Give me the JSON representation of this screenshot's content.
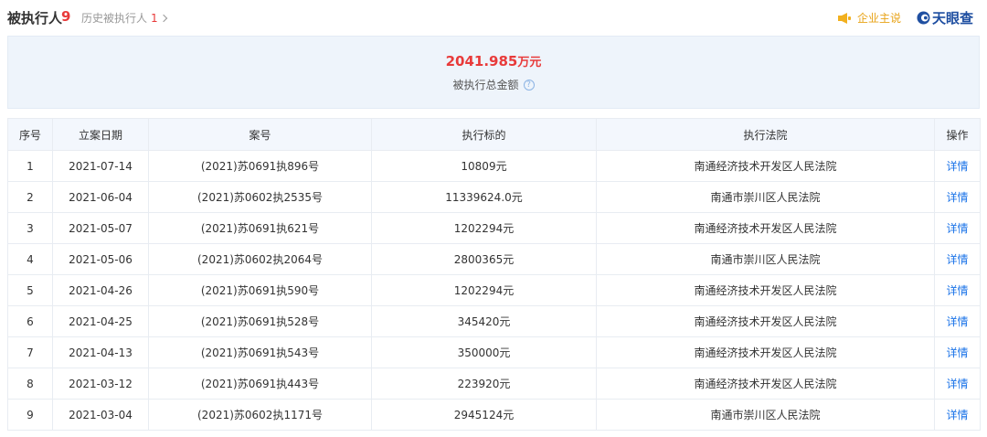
{
  "header": {
    "title": "被执行人",
    "title_count": "9",
    "history_label": "历史被执行人",
    "history_count": "1",
    "enterprise_say_label": "企业主说",
    "logo_text": "天眼查"
  },
  "summary": {
    "amount": "2041.985",
    "amount_unit": "万元",
    "label": "被执行总金额"
  },
  "table": {
    "columns": [
      "序号",
      "立案日期",
      "案号",
      "执行标的",
      "执行法院",
      "操作"
    ],
    "rows": [
      {
        "no": "1",
        "date": "2021-07-14",
        "case_no": "(2021)苏0691执896号",
        "amount": "10809元",
        "court": "南通经济技术开发区人民法院",
        "action": "详情"
      },
      {
        "no": "2",
        "date": "2021-06-04",
        "case_no": "(2021)苏0602执2535号",
        "amount": "11339624.0元",
        "court": "南通市崇川区人民法院",
        "action": "详情"
      },
      {
        "no": "3",
        "date": "2021-05-07",
        "case_no": "(2021)苏0691执621号",
        "amount": "1202294元",
        "court": "南通经济技术开发区人民法院",
        "action": "详情"
      },
      {
        "no": "4",
        "date": "2021-05-06",
        "case_no": "(2021)苏0602执2064号",
        "amount": "2800365元",
        "court": "南通市崇川区人民法院",
        "action": "详情"
      },
      {
        "no": "5",
        "date": "2021-04-26",
        "case_no": "(2021)苏0691执590号",
        "amount": "1202294元",
        "court": "南通经济技术开发区人民法院",
        "action": "详情"
      },
      {
        "no": "6",
        "date": "2021-04-25",
        "case_no": "(2021)苏0691执528号",
        "amount": "345420元",
        "court": "南通经济技术开发区人民法院",
        "action": "详情"
      },
      {
        "no": "7",
        "date": "2021-04-13",
        "case_no": "(2021)苏0691执543号",
        "amount": "350000元",
        "court": "南通经济技术开发区人民法院",
        "action": "详情"
      },
      {
        "no": "8",
        "date": "2021-03-12",
        "case_no": "(2021)苏0691执443号",
        "amount": "223920元",
        "court": "南通经济技术开发区人民法院",
        "action": "详情"
      },
      {
        "no": "9",
        "date": "2021-03-04",
        "case_no": "(2021)苏0602执1171号",
        "amount": "2945124元",
        "court": "南通市崇川区人民法院",
        "action": "详情"
      }
    ]
  },
  "colors": {
    "accent_red": "#e83a3a",
    "link_blue": "#1a73e8",
    "summary_bg": "#eef4fb",
    "header_bg": "#f3f7fd",
    "enterprise_orange": "#e8a317",
    "logo_blue": "#1f4fa1"
  },
  "icons": {
    "speaker": "speaker-icon",
    "help": "help-icon",
    "logo": "tianyancha-logo-icon",
    "chevron": "chevron-right-icon"
  }
}
